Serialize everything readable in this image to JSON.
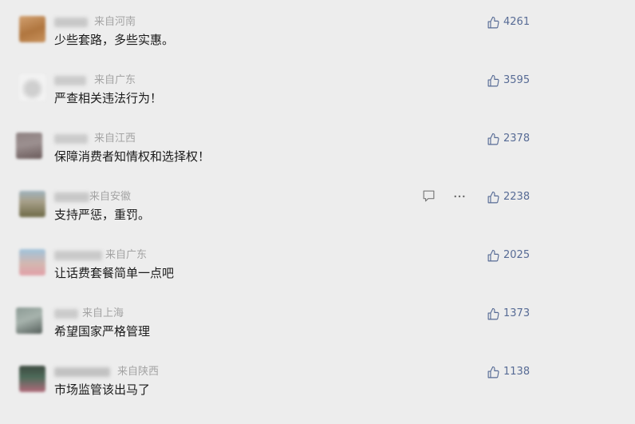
{
  "colors": {
    "background": "#ededed",
    "content_text": "#1b1b1b",
    "meta_text": "#a3a3a3",
    "like_accent": "#576b95"
  },
  "icons": {
    "like": "thumbs-up-icon",
    "reply": "reply-icon",
    "more": "more-icon"
  },
  "comments": [
    {
      "region": "来自河南",
      "content": "少些套路，多些实惠。",
      "likes": "4261"
    },
    {
      "region": "来自广东",
      "content": "严查相关违法行为！",
      "likes": "3595"
    },
    {
      "region": "来自江西",
      "content": "保障消费者知情权和选择权！",
      "likes": "2378"
    },
    {
      "region": "来自安徽",
      "content": "支持严惩，重罚。",
      "likes": "2238"
    },
    {
      "region": "来自广东",
      "content": "让话费套餐简单一点吧",
      "likes": "2025"
    },
    {
      "region": "来自上海",
      "content": "希望国家严格管理",
      "likes": "1373"
    },
    {
      "region": "来自陕西",
      "content": "市场监管该出马了",
      "likes": "1138"
    }
  ]
}
